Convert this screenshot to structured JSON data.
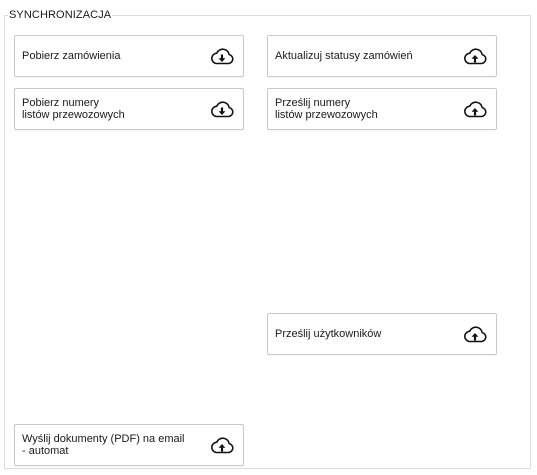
{
  "section": {
    "title": "SYNCHRONIZACJA"
  },
  "buttons": {
    "pobierz_zamowienia": {
      "label": "Pobierz zamówienia",
      "icon": "cloud-download-icon"
    },
    "aktualizuj_statusy": {
      "label": "Aktualizuj statusy zamówień",
      "icon": "cloud-upload-icon"
    },
    "pobierz_numery": {
      "label": "Pobierz numery\nlistów przewozowych",
      "icon": "cloud-download-icon"
    },
    "przeslij_numery": {
      "label": "Prześlij numery\nlistów przewozowych",
      "icon": "cloud-upload-icon"
    },
    "przeslij_uzytkownikow": {
      "label": "Prześlij użytkowników",
      "icon": "cloud-upload-icon"
    },
    "wyslij_dokumenty": {
      "label": "Wyślij dokumenty (PDF) na email\n- automat",
      "icon": "cloud-upload-icon"
    }
  }
}
